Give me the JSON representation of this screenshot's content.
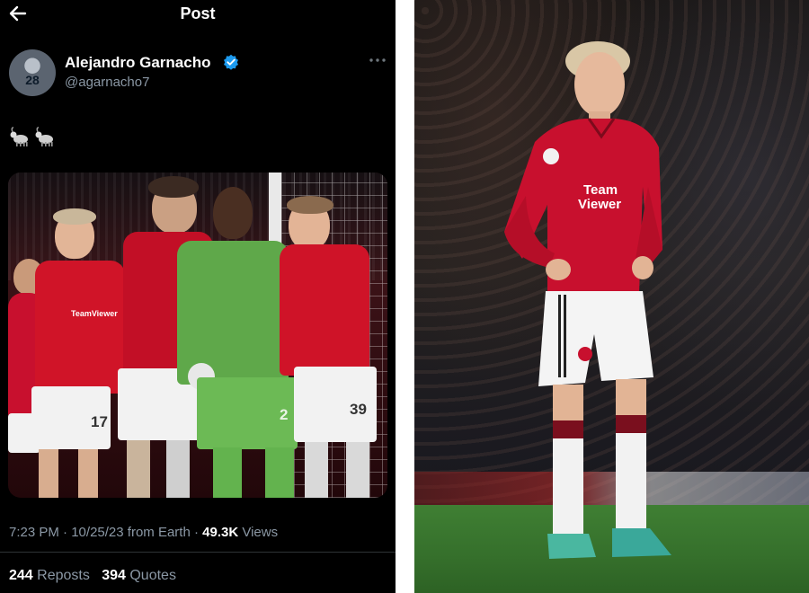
{
  "topbar": {
    "title": "Post"
  },
  "tweet": {
    "author_name": "Alejandro Garnacho",
    "handle": "@agarnacho7",
    "avatar_number": "28",
    "body_text": "🐐🐐",
    "time": "7:23 PM",
    "date": "10/25/23",
    "source": "from Earth",
    "views_count": "49.3K",
    "views_label": "Views",
    "reposts_count": "244",
    "reposts_label": "Reposts",
    "quotes_count": "394",
    "quotes_label": "Quotes"
  },
  "media": {
    "jersey_numbers": [
      "17",
      "2",
      "39"
    ],
    "sponsor": "TeamViewer"
  },
  "colors": {
    "background": "#000000",
    "text": "#e7e9ea",
    "muted": "#8b98a5",
    "verified": "#1d9bf0",
    "kit_red": "#c8102e",
    "keeper_green": "#5fa84a"
  },
  "icons": [
    "back-arrow-icon",
    "verified-badge-icon",
    "more-icon",
    "goat-emoji"
  ]
}
